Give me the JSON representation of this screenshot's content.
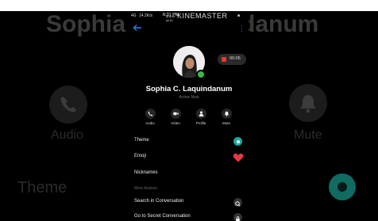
{
  "background": {
    "contact_name": "Sophia C. Laquindanum",
    "audio_label": "Audio",
    "mute_label": "Mute",
    "theme_label": "Theme"
  },
  "status_bar": {
    "network": "4G",
    "speed": "14.2K/s",
    "time": "6:31 PM",
    "battery": "■",
    "watermark_prefix": "Made with",
    "watermark": "KINEMASTER"
  },
  "call_timer": "00:05",
  "profile": {
    "name": "Sophia C. Laquindanum",
    "status": "Active Now"
  },
  "actions": [
    {
      "label": "Audio",
      "icon": "phone-icon"
    },
    {
      "label": "Video",
      "icon": "video-icon"
    },
    {
      "label": "Profile",
      "icon": "profile-icon"
    },
    {
      "label": "Mute",
      "icon": "bell-icon"
    }
  ],
  "menu": {
    "theme": "Theme",
    "emoji": "Emoji",
    "nicknames": "Nicknames",
    "more_actions": "More Actions",
    "search": "Search in Conversation",
    "secret": "Go to Secret Conversation"
  },
  "colors": {
    "accent": "#2e7de9",
    "theme_dot": "#1fa89a",
    "emoji_heart": "#e53945",
    "online": "#3db748"
  }
}
